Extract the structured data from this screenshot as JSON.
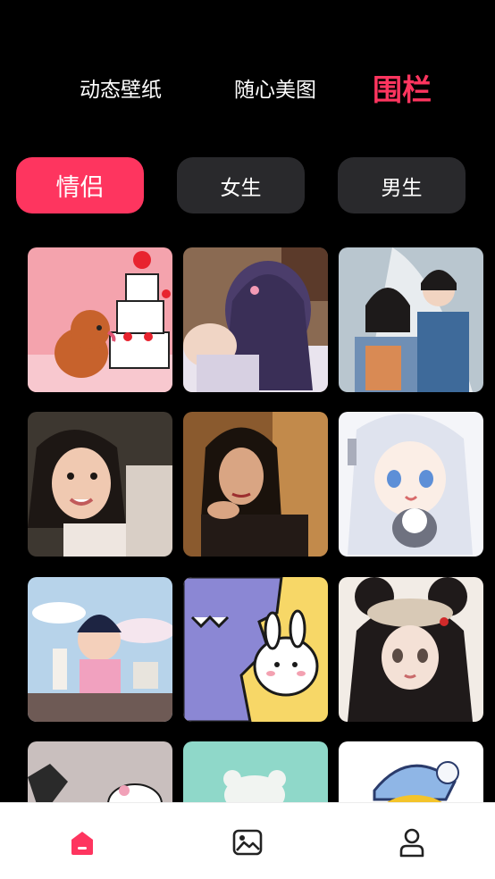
{
  "colors": {
    "accent": "#fe355f",
    "chip_inactive": "#29292c",
    "background": "#000000",
    "nav_icon": "#222222"
  },
  "top_tabs": [
    {
      "label": "动态壁纸",
      "active": false
    },
    {
      "label": "随心美图",
      "active": false
    },
    {
      "label": "围栏",
      "active": true
    }
  ],
  "chips": [
    {
      "label": "情侣",
      "active": true
    },
    {
      "label": "女生",
      "active": false
    },
    {
      "label": "男生",
      "active": false
    }
  ],
  "gallery": [
    {
      "subject": "cartoon dog with cake"
    },
    {
      "subject": "anime girl with long hair"
    },
    {
      "subject": "couple photo"
    },
    {
      "subject": "smiling girl"
    },
    {
      "subject": "woman portrait"
    },
    {
      "subject": "anime girl with white hair and cat"
    },
    {
      "subject": "cartoon boy"
    },
    {
      "subject": "cartoon monster and bunny"
    },
    {
      "subject": "anime girl with mouse ears"
    },
    {
      "subject": "cartoon cats"
    },
    {
      "subject": "white bear toy"
    },
    {
      "subject": "yellow character with blue hat"
    }
  ],
  "bottom_nav": [
    {
      "icon": "home-icon",
      "active": true
    },
    {
      "icon": "image-icon",
      "active": false
    },
    {
      "icon": "profile-icon",
      "active": false
    }
  ]
}
